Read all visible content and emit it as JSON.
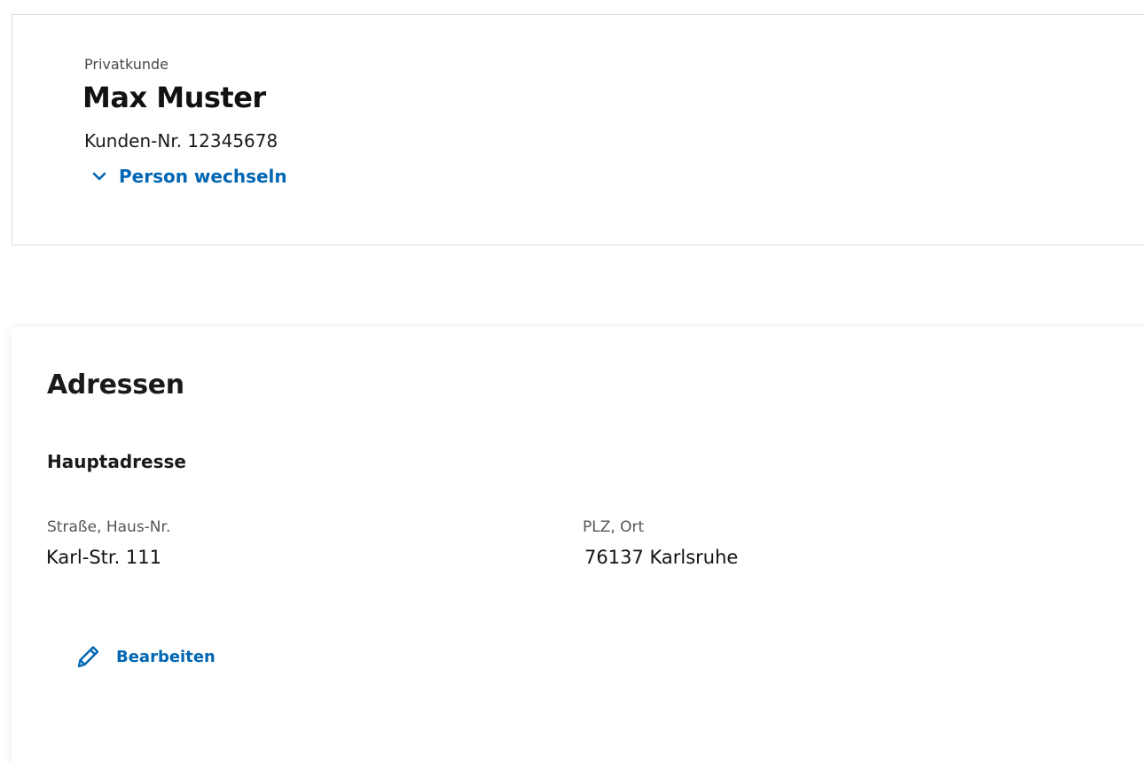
{
  "customer": {
    "type_label": "Privatkunde",
    "name": "Max Muster",
    "number_label": "Kunden-Nr. 12345678",
    "switch_person_label": "Person wechseln",
    "switch_icon": "chevron-down-icon"
  },
  "addresses": {
    "title": "Adressen",
    "main_address": {
      "heading": "Hauptadresse",
      "street_label": "Straße, Haus-Nr.",
      "street_value": "Karl-Str. 111",
      "city_label": "PLZ, Ort",
      "city_value": "76137 Karlsruhe"
    },
    "edit_label": "Bearbeiten",
    "edit_icon": "pencil-icon"
  },
  "colors": {
    "accent": "#0066b3",
    "text": "#1a1a1a",
    "muted": "#555555",
    "border": "#d9d9d9"
  }
}
